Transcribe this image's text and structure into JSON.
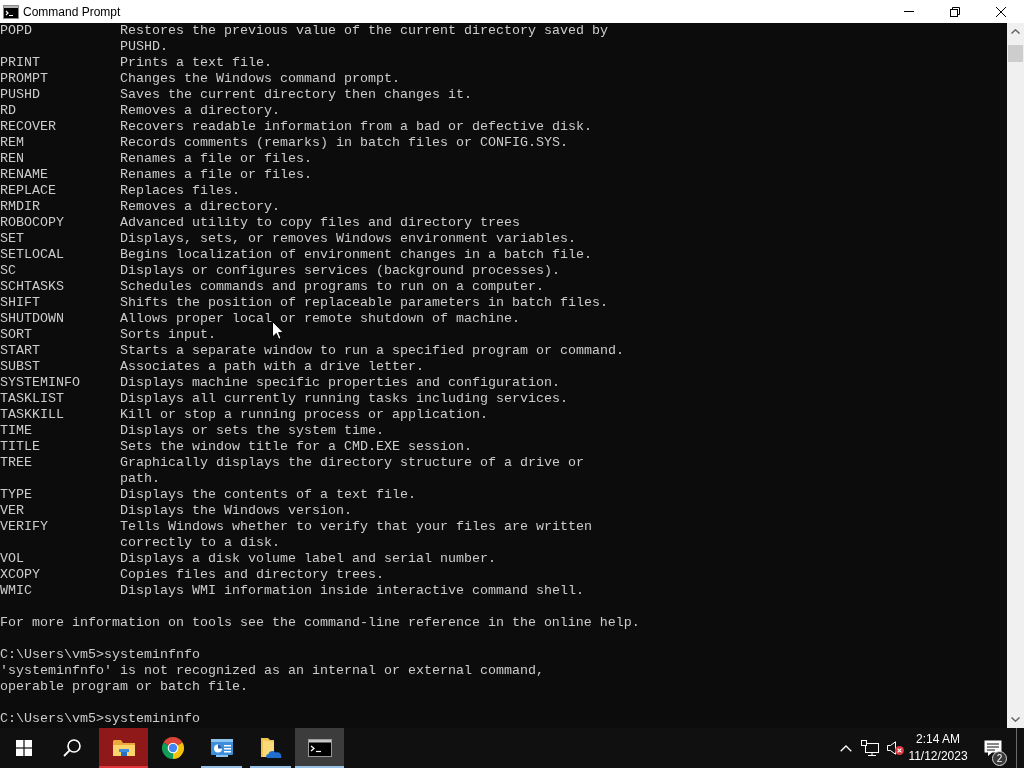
{
  "window": {
    "title": "Command Prompt"
  },
  "console": {
    "commands": [
      {
        "name": "POPD",
        "description": "Restores the previous value of the current directory saved by\nPUSHD."
      },
      {
        "name": "PRINT",
        "description": "Prints a text file."
      },
      {
        "name": "PROMPT",
        "description": "Changes the Windows command prompt."
      },
      {
        "name": "PUSHD",
        "description": "Saves the current directory then changes it."
      },
      {
        "name": "RD",
        "description": "Removes a directory."
      },
      {
        "name": "RECOVER",
        "description": "Recovers readable information from a bad or defective disk."
      },
      {
        "name": "REM",
        "description": "Records comments (remarks) in batch files or CONFIG.SYS."
      },
      {
        "name": "REN",
        "description": "Renames a file or files."
      },
      {
        "name": "RENAME",
        "description": "Renames a file or files."
      },
      {
        "name": "REPLACE",
        "description": "Replaces files."
      },
      {
        "name": "RMDIR",
        "description": "Removes a directory."
      },
      {
        "name": "ROBOCOPY",
        "description": "Advanced utility to copy files and directory trees"
      },
      {
        "name": "SET",
        "description": "Displays, sets, or removes Windows environment variables."
      },
      {
        "name": "SETLOCAL",
        "description": "Begins localization of environment changes in a batch file."
      },
      {
        "name": "SC",
        "description": "Displays or configures services (background processes)."
      },
      {
        "name": "SCHTASKS",
        "description": "Schedules commands and programs to run on a computer."
      },
      {
        "name": "SHIFT",
        "description": "Shifts the position of replaceable parameters in batch files."
      },
      {
        "name": "SHUTDOWN",
        "description": "Allows proper local or remote shutdown of machine."
      },
      {
        "name": "SORT",
        "description": "Sorts input."
      },
      {
        "name": "START",
        "description": "Starts a separate window to run a specified program or command."
      },
      {
        "name": "SUBST",
        "description": "Associates a path with a drive letter."
      },
      {
        "name": "SYSTEMINFO",
        "description": "Displays machine specific properties and configuration."
      },
      {
        "name": "TASKLIST",
        "description": "Displays all currently running tasks including services."
      },
      {
        "name": "TASKKILL",
        "description": "Kill or stop a running process or application."
      },
      {
        "name": "TIME",
        "description": "Displays or sets the system time."
      },
      {
        "name": "TITLE",
        "description": "Sets the window title for a CMD.EXE session."
      },
      {
        "name": "TREE",
        "description": "Graphically displays the directory structure of a drive or\npath."
      },
      {
        "name": "TYPE",
        "description": "Displays the contents of a text file."
      },
      {
        "name": "VER",
        "description": "Displays the Windows version."
      },
      {
        "name": "VERIFY",
        "description": "Tells Windows whether to verify that your files are written\ncorrectly to a disk."
      },
      {
        "name": "VOL",
        "description": "Displays a disk volume label and serial number."
      },
      {
        "name": "XCOPY",
        "description": "Copies files and directory trees."
      },
      {
        "name": "WMIC",
        "description": "Displays WMI information inside interactive command shell."
      }
    ],
    "footer": "For more information on tools see the command-line reference in the online help.",
    "transcript": [
      {
        "command": "C:\\Users\\vm5>systeminfnfo",
        "output": "'systeminfnfo' is not recognized as an internal or external command,\noperable program or batch file."
      },
      {
        "command": "C:\\Users\\vm5>systemininfo"
      }
    ]
  },
  "taskbar": {
    "apps": [
      {
        "kind": "explorer",
        "running": true,
        "active": false,
        "attention": true
      },
      {
        "kind": "browser",
        "running": false,
        "active": false,
        "attention": false
      },
      {
        "kind": "dashboard",
        "running": true,
        "active": false,
        "attention": false
      },
      {
        "kind": "folder",
        "running": true,
        "active": false,
        "attention": false
      },
      {
        "kind": "terminal",
        "running": true,
        "active": true,
        "attention": false
      }
    ],
    "tray": {
      "sound_muted": true,
      "time": "2:14 AM",
      "date": "11/12/2023",
      "notification_count": "2"
    }
  }
}
